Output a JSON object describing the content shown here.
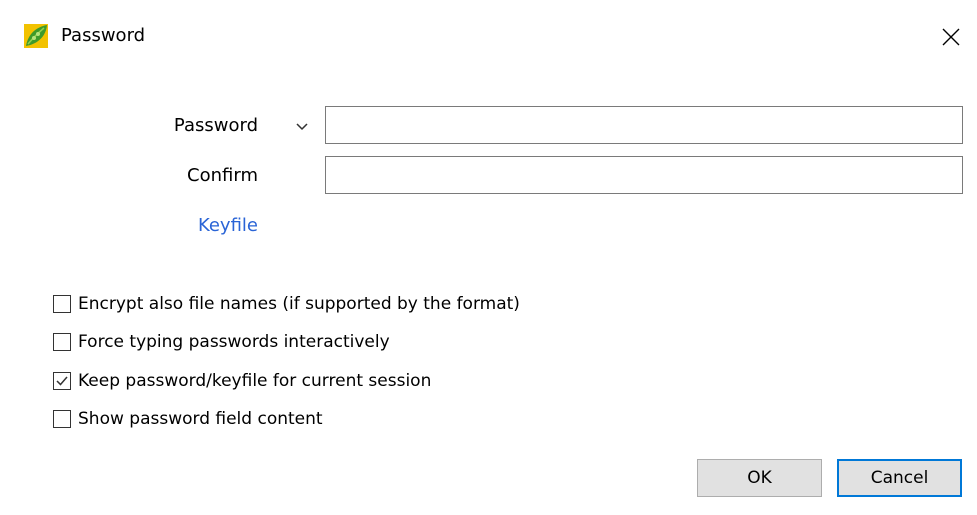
{
  "window": {
    "title": "Password",
    "app_icon": "peazip-leaf-icon",
    "close_icon": "close-icon"
  },
  "form": {
    "password_label": "Password",
    "password_value": "",
    "password_dropdown_icon": "chevron-down-icon",
    "confirm_label": "Confirm",
    "confirm_value": "",
    "keyfile_link": "Keyfile"
  },
  "options": [
    {
      "label": "Encrypt also file names (if supported by the format)",
      "checked": false
    },
    {
      "label": "Force typing passwords interactively",
      "checked": false
    },
    {
      "label": "Keep password/keyfile for current session",
      "checked": true
    },
    {
      "label": "Show password field content",
      "checked": false
    }
  ],
  "buttons": {
    "ok": "OK",
    "cancel": "Cancel"
  },
  "colors": {
    "link": "#2a64d6",
    "focus_border": "#0078d7",
    "button_bg": "#e1e1e1"
  }
}
